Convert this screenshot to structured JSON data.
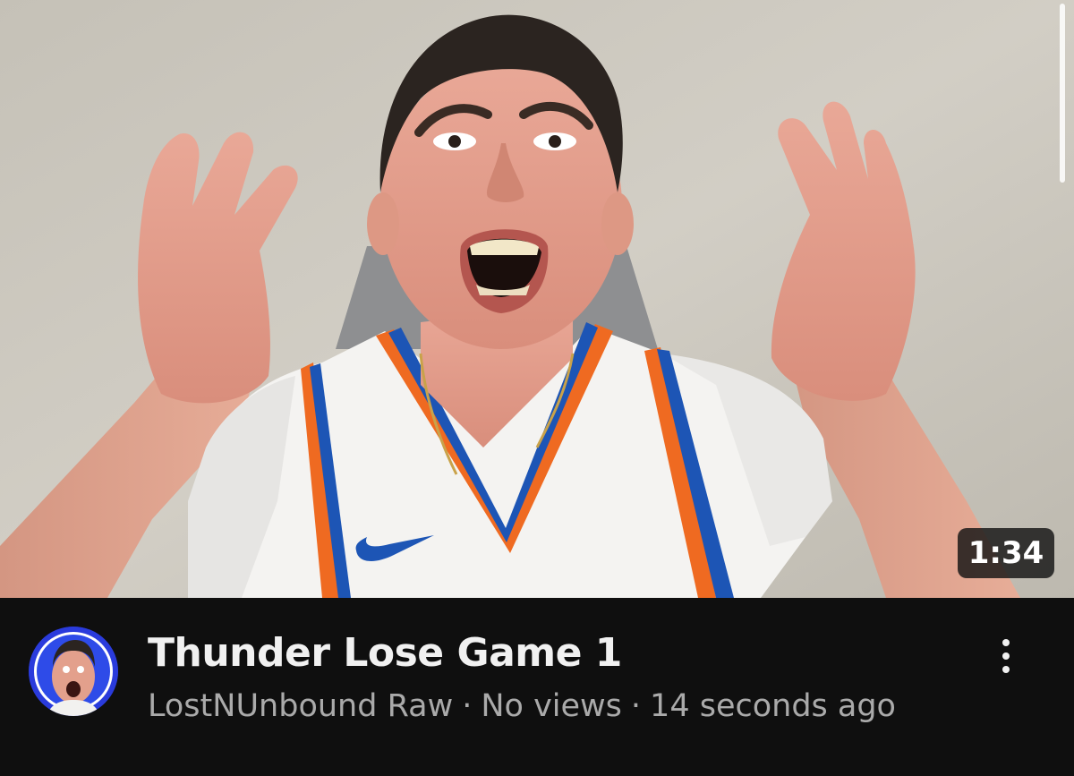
{
  "video": {
    "title": "Thunder Lose Game 1",
    "duration": "1:34",
    "channel": "LostNUnbound Raw",
    "views": "No views",
    "age": "14 seconds ago",
    "separator": "·"
  },
  "icons": {
    "more": "more-vertical-icon"
  },
  "colors": {
    "background": "#0f0f0f",
    "title": "#f1f1f1",
    "meta": "#aaaaaa",
    "badge_bg": "#141414",
    "avatar_ring": "#2a3bdc"
  }
}
